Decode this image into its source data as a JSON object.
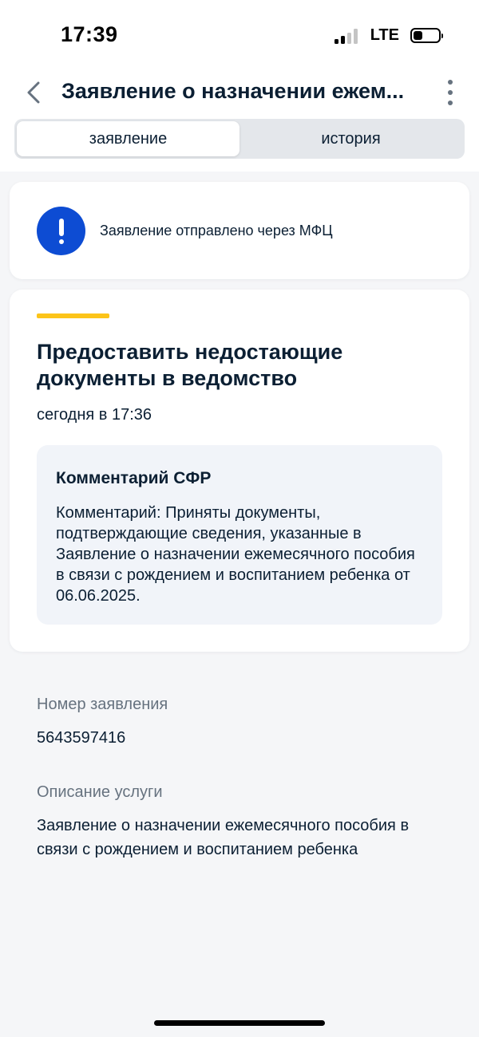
{
  "status_bar": {
    "time": "17:39",
    "network": "LTE",
    "icons": [
      "signal-icon",
      "battery-icon"
    ]
  },
  "header": {
    "title": "Заявление о назначении ежем...",
    "back_icon": "chevron-left-icon",
    "more_icon": "more-vertical-icon"
  },
  "tabs": [
    {
      "label": "заявление",
      "active": true
    },
    {
      "label": "история",
      "active": false
    }
  ],
  "notice": {
    "icon": "exclamation-icon",
    "text": "Заявление отправлено через МФЦ",
    "icon_color": "#0d4cd3"
  },
  "task": {
    "accent_color": "#fcc419",
    "title": "Предоставить недостающие документы в ведомство",
    "date": "сегодня в 17:36",
    "comment": {
      "title": "Комментарий СФР",
      "text": "Комментарий: Приняты документы, подтверждающие сведения, указанные в Заявление о назначении ежемесячного пособия в связи с рождением и воспитанием ребенка от 06.06.2025."
    }
  },
  "details": {
    "number_label": "Номер заявления",
    "number_value": "5643597416",
    "description_label": "Описание услуги",
    "description_value": "Заявление о назначении ежемесячного пособия в связи с рождением и воспитанием ребенка"
  }
}
